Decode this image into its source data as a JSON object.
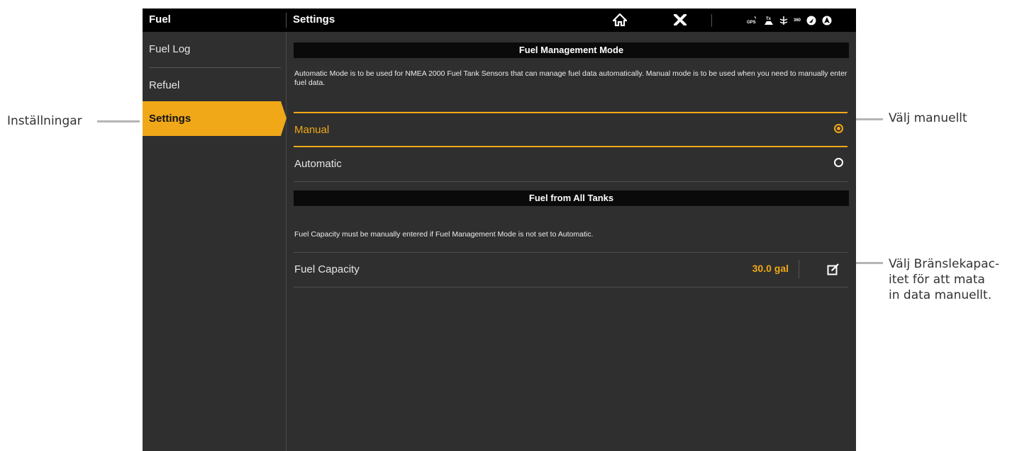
{
  "topbar": {
    "left_title": "Fuel",
    "right_title": "Settings",
    "icons": [
      "home-icon",
      "close-icon",
      "gps-icon",
      "transmit-icon",
      "sonar-icon",
      "360-icon",
      "navigation-icon",
      "autopilot-icon"
    ],
    "status_360_label": "360"
  },
  "sidebar": {
    "items": [
      {
        "label": "Fuel Log"
      },
      {
        "label": "Refuel"
      },
      {
        "label": "Settings",
        "active": true
      }
    ]
  },
  "main": {
    "mode_section": {
      "header": "Fuel Management Mode",
      "description": "Automatic Mode is to be used for NMEA 2000 Fuel Tank Sensors that can manage fuel data automatically. Manual mode is to be used when you need to manually enter fuel data.",
      "options": [
        {
          "label": "Manual",
          "selected": true
        },
        {
          "label": "Automatic",
          "selected": false
        }
      ]
    },
    "tanks_section": {
      "header": "Fuel from All Tanks",
      "description": "Fuel Capacity must be manually entered if Fuel Management Mode is not set to Automatic.",
      "capacity_label": "Fuel Capacity",
      "capacity_value": "30.0 gal"
    }
  },
  "callouts": {
    "settings": "Inställningar",
    "manual": "Välj manuellt",
    "capacity_line1": "Välj Bränslekapac-",
    "capacity_line2": "itet för att mata",
    "capacity_line3": "in data manuellt."
  },
  "colors": {
    "accent": "#f0a818",
    "background": "#2f2f2f",
    "topbar": "#000000"
  }
}
